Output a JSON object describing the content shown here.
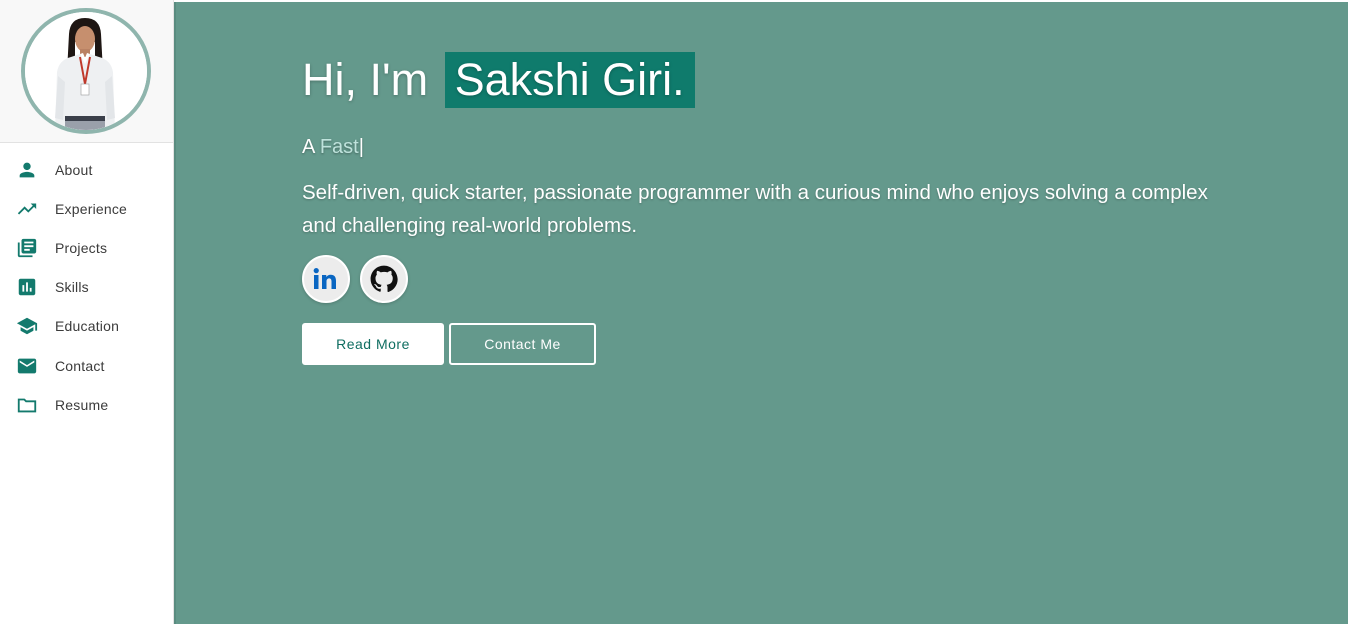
{
  "profile": {
    "avatar_alt": "Sakshi Giri"
  },
  "sidebar": {
    "items": [
      {
        "label": "About",
        "icon": "person-icon"
      },
      {
        "label": "Experience",
        "icon": "trending-up-icon"
      },
      {
        "label": "Projects",
        "icon": "library-books-icon"
      },
      {
        "label": "Skills",
        "icon": "bar-chart-icon"
      },
      {
        "label": "Education",
        "icon": "school-icon"
      },
      {
        "label": "Contact",
        "icon": "mail-icon"
      },
      {
        "label": "Resume",
        "icon": "folder-icon"
      }
    ]
  },
  "hero": {
    "greeting": "Hi, I'm",
    "name": "Sakshi Giri.",
    "tagline_prefix": "A",
    "tagline_typed": "Fast",
    "cursor": "|",
    "bio": "Self-driven, quick starter, passionate programmer with a curious mind who enjoys solving a complex and challenging real-world problems.",
    "socials": [
      {
        "name": "LinkedIn",
        "icon": "linkedin-icon"
      },
      {
        "name": "GitHub",
        "icon": "github-icon"
      }
    ],
    "read_more_label": "Read More",
    "contact_label": "Contact Me"
  },
  "colors": {
    "accent": "#0f7b6c",
    "main_bg": "#64998c",
    "icon": "#137a6d"
  }
}
